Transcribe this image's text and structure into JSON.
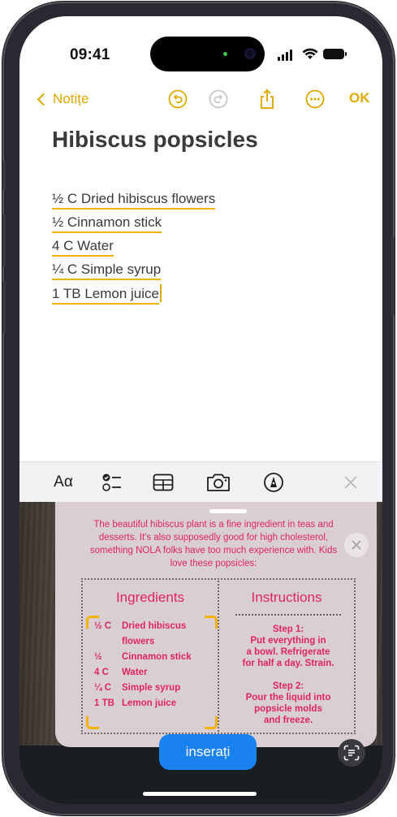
{
  "status": {
    "time": "09:41"
  },
  "nav": {
    "back_label": "Notițe",
    "ok_label": "OK"
  },
  "note": {
    "title": "Hibiscus popsicles",
    "lines": [
      "½ C Dried hibiscus flowers",
      "½ Cinnamon stick",
      "4 C Water",
      "¼ C Simple syrup",
      "1 TB Lemon juice"
    ]
  },
  "toolbar": {
    "format_label": "Aα"
  },
  "card": {
    "intro": "The beautiful hibiscus plant is a fine ingredient in teas and desserts. It's also supposedly good for high cholesterol, something NOLA folks have too much experience with. Kids love these popsicles:",
    "ingredients_title": "Ingredients",
    "instructions_title": "Instructions",
    "ingredients": [
      {
        "q": "½ C",
        "name": "Dried hibiscus"
      },
      {
        "q": "",
        "name": "flowers"
      },
      {
        "q": "½",
        "name": "Cinnamon stick"
      },
      {
        "q": "4 C",
        "name": "Water"
      },
      {
        "q": "¼ C",
        "name": "Simple syrup"
      },
      {
        "q": "1 TB",
        "name": "Lemon juice"
      }
    ],
    "step1_title": "Step 1:",
    "step1_lines": [
      "Put everything in",
      "a bowl. Refrigerate",
      "for half a day. Strain."
    ],
    "step2_title": "Step 2:",
    "step2_lines": [
      "Pour the liquid into",
      "popsicle molds",
      "and freeze."
    ]
  },
  "insert_button": "inserați",
  "colors": {
    "accent": "#e0a800",
    "recipe_text": "#e0245e",
    "insert_button": "#1a82f0"
  },
  "icons": [
    "chevron-left-icon",
    "undo-icon",
    "redo-icon",
    "share-icon",
    "more-icon",
    "checklist-icon",
    "table-icon",
    "camera-icon",
    "markup-icon",
    "close-icon",
    "scan-text-icon"
  ]
}
